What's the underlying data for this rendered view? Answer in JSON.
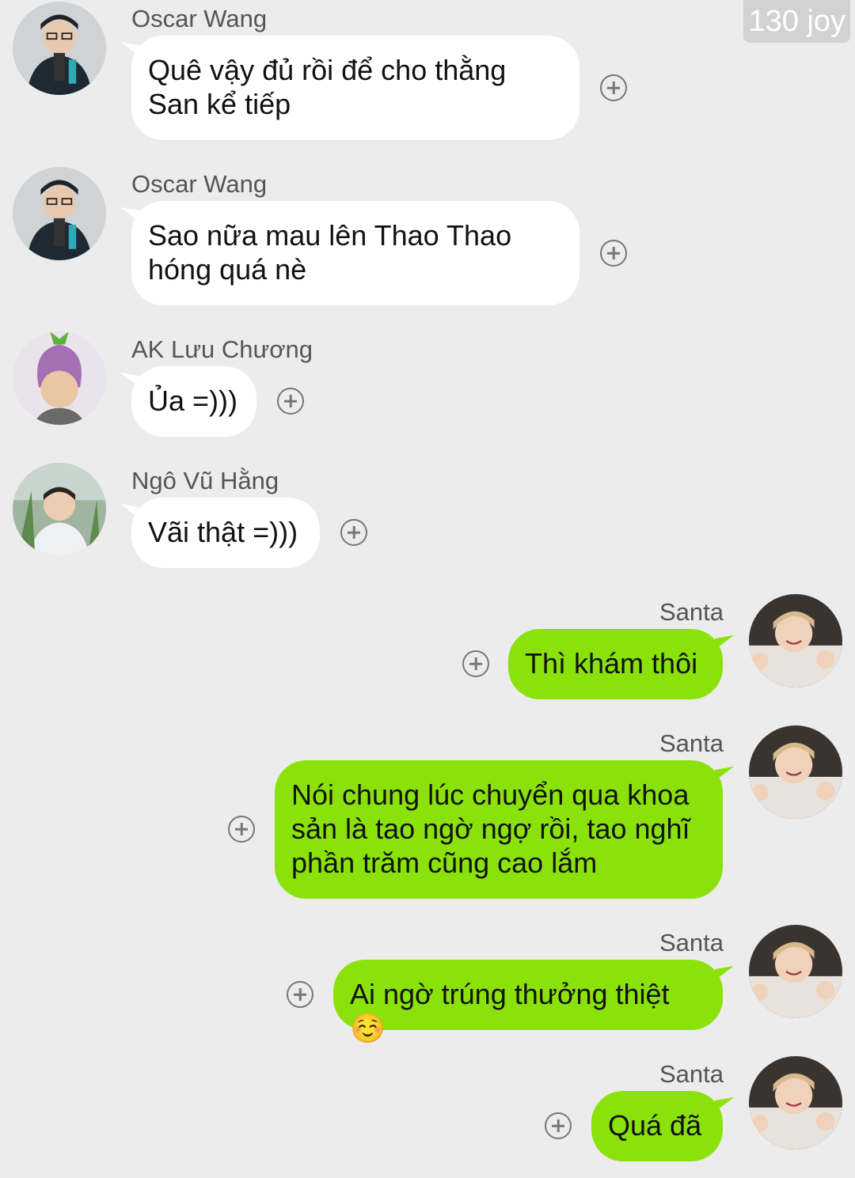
{
  "header": {
    "badge": "130 joy"
  },
  "messages": [
    {
      "sender": "Oscar Wang",
      "text": "Quê vậy đủ rồi để cho thằng San kể tiếp",
      "direction": "incoming",
      "avatar": "oscar-avatar"
    },
    {
      "sender": "Oscar Wang",
      "text": "Sao nữa mau lên Thao Thao hóng quá nè",
      "direction": "incoming",
      "avatar": "oscar-avatar"
    },
    {
      "sender": "AK Lưu Chương",
      "text": "Ủa =)))",
      "direction": "incoming",
      "avatar": "eggplant-hat-avatar"
    },
    {
      "sender": "Ngô Vũ Hằng",
      "text": "Vãi thật =)))",
      "direction": "incoming",
      "avatar": "outdoor-portrait-avatar"
    },
    {
      "sender": "Santa",
      "text": "Thì khám thôi",
      "direction": "outgoing",
      "avatar": "santa-avatar"
    },
    {
      "sender": "Santa",
      "text": "Nói chung lúc chuyển qua khoa sản là tao ngờ ngợ rồi, tao nghĩ phần trăm cũng cao lắm",
      "direction": "outgoing",
      "avatar": "santa-avatar"
    },
    {
      "sender": "Santa",
      "text": "Ai ngờ trúng thưởng thiệt ☺️",
      "direction": "outgoing",
      "avatar": "santa-avatar"
    },
    {
      "sender": "Santa",
      "text": "Quá đã",
      "direction": "outgoing",
      "avatar": "santa-avatar"
    }
  ],
  "colors": {
    "background": "#ececec",
    "incoming_bubble": "#ffffff",
    "outgoing_bubble": "#8ae20a"
  }
}
